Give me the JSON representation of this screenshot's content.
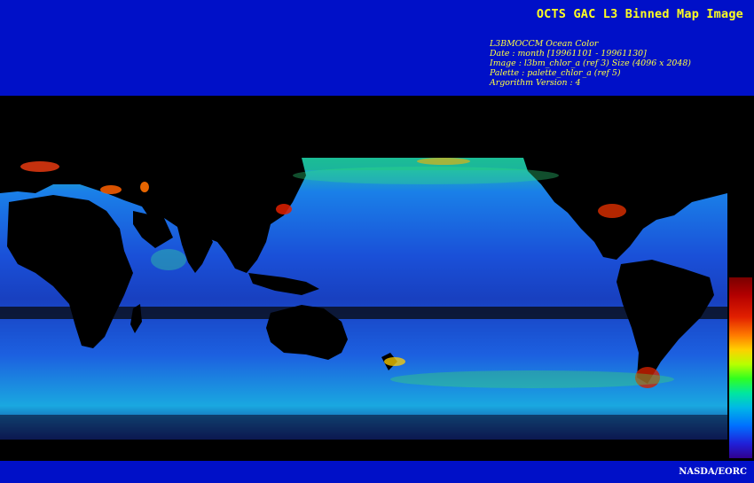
{
  "header": {
    "title": "OCTS GAC L3 Binned Map Image",
    "meta_lines": [
      "L3BMOCCM Ocean Color",
      "Date : month [19961101 - 19961130]",
      "Image : l3bm_chlor_a (ref 3) Size (4096 x 2048)",
      "Palette : palette_chlor_a (ref 5)",
      "Argorithm Version : 4"
    ]
  },
  "map": {
    "ocean_color": "#1e55e0",
    "land_color": "#000000",
    "colorbar": {
      "top_color": "#7a0000",
      "bottom_color": "#300090"
    }
  },
  "footer": {
    "credit": "NASDA/EORC"
  },
  "colors": {
    "banner_blue": "#0010c8",
    "title_yellow": "#ffff20"
  }
}
